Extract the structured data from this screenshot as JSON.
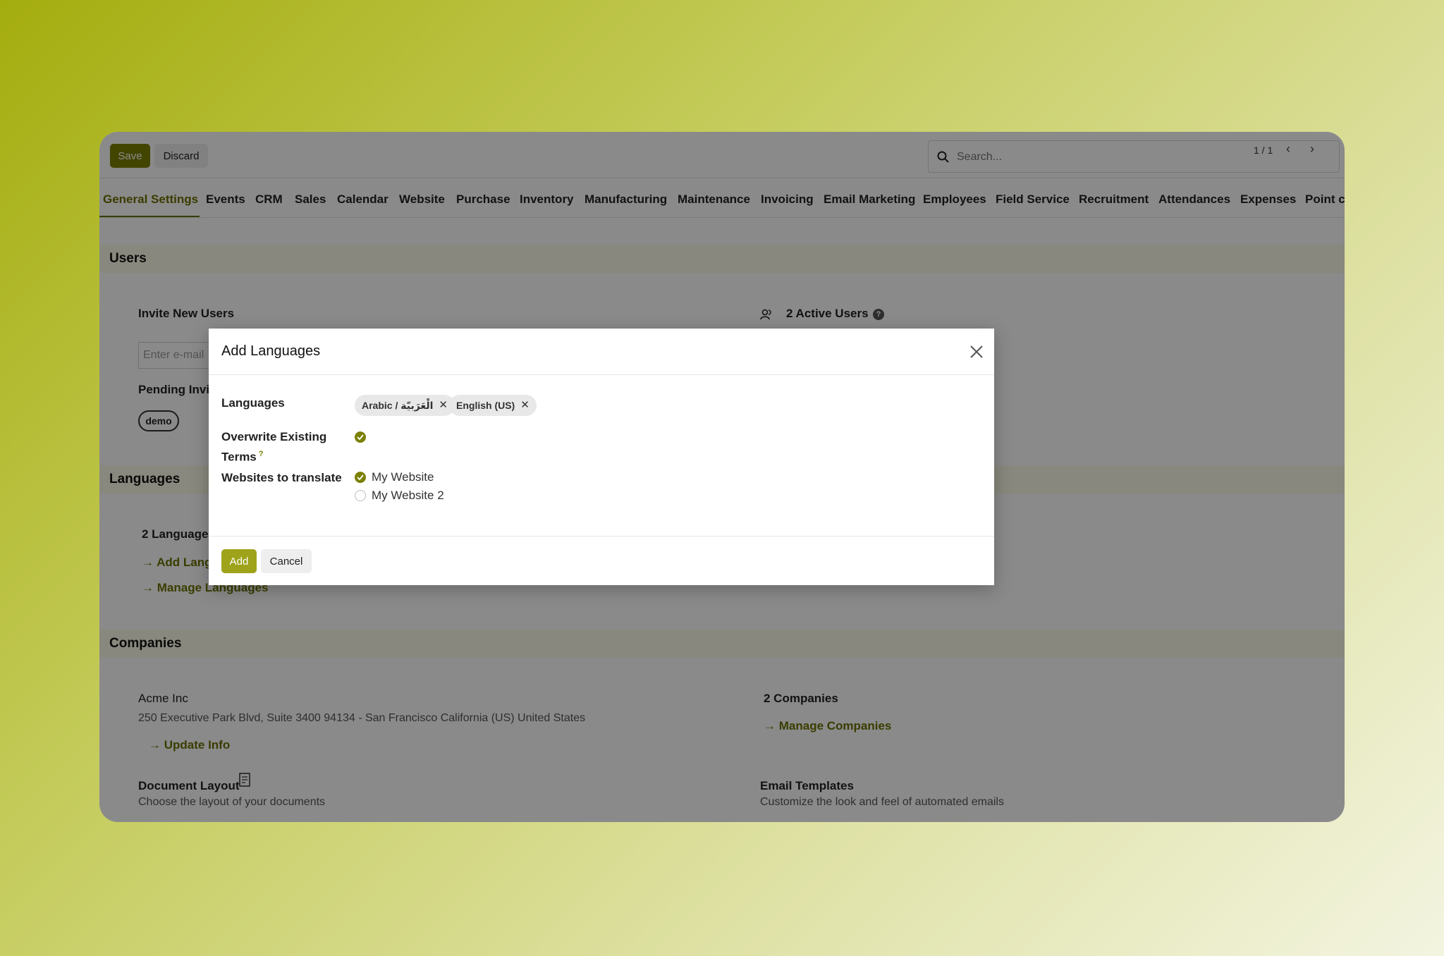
{
  "toolbar": {
    "save_label": "Save",
    "discard_label": "Discard"
  },
  "search": {
    "placeholder": "Search..."
  },
  "pager": {
    "text": "1 / 1",
    "prev": "‹",
    "next": "›"
  },
  "tabs": [
    "General Settings",
    "Events",
    "CRM",
    "Sales",
    "Calendar",
    "Website",
    "Purchase",
    "Inventory",
    "Manufacturing",
    "Maintenance",
    "Invoicing",
    "Email Marketing",
    "Employees",
    "Field Service",
    "Recruitment",
    "Attendances",
    "Expenses",
    "Point c"
  ],
  "users": {
    "section_title": "Users",
    "invite_label": "Invite New Users",
    "email_placeholder": "Enter e-mail",
    "pending_label": "Pending Invit",
    "pending_tag": "demo",
    "active_users": "2 Active Users"
  },
  "languages": {
    "section_title": "Languages",
    "count": "2 Languages",
    "add_link": "Add Lang",
    "manage_link": "Manage Languages"
  },
  "companies": {
    "section_title": "Companies",
    "company_name": "Acme Inc",
    "address": "250 Executive Park Blvd, Suite 3400 94134 - San Francisco California (US) United States",
    "update_link": "Update Info",
    "count": "2 Companies",
    "manage_link": "Manage Companies",
    "doc_layout_title": "Document Layout",
    "doc_layout_desc": "Choose the layout of your documents",
    "email_templates_title": "Email Templates",
    "email_templates_desc": "Customize the look and feel of automated emails"
  },
  "modal": {
    "title": "Add Languages",
    "languages_label": "Languages",
    "tags": [
      "Arabic / الْعَرَبيّة",
      "English (US)"
    ],
    "overwrite_label_1": "Overwrite Existing",
    "overwrite_label_2": "Terms",
    "overwrite_help": "?",
    "overwrite_checked": true,
    "websites_label": "Websites to translate",
    "websites": [
      {
        "name": "My Website",
        "checked": true
      },
      {
        "name": "My Website 2",
        "checked": false
      }
    ],
    "add_label": "Add",
    "cancel_label": "Cancel"
  },
  "colors": {
    "accent": "#7a8000",
    "accent_light": "#9ea31a",
    "section_bg": "#fbfbe9"
  }
}
